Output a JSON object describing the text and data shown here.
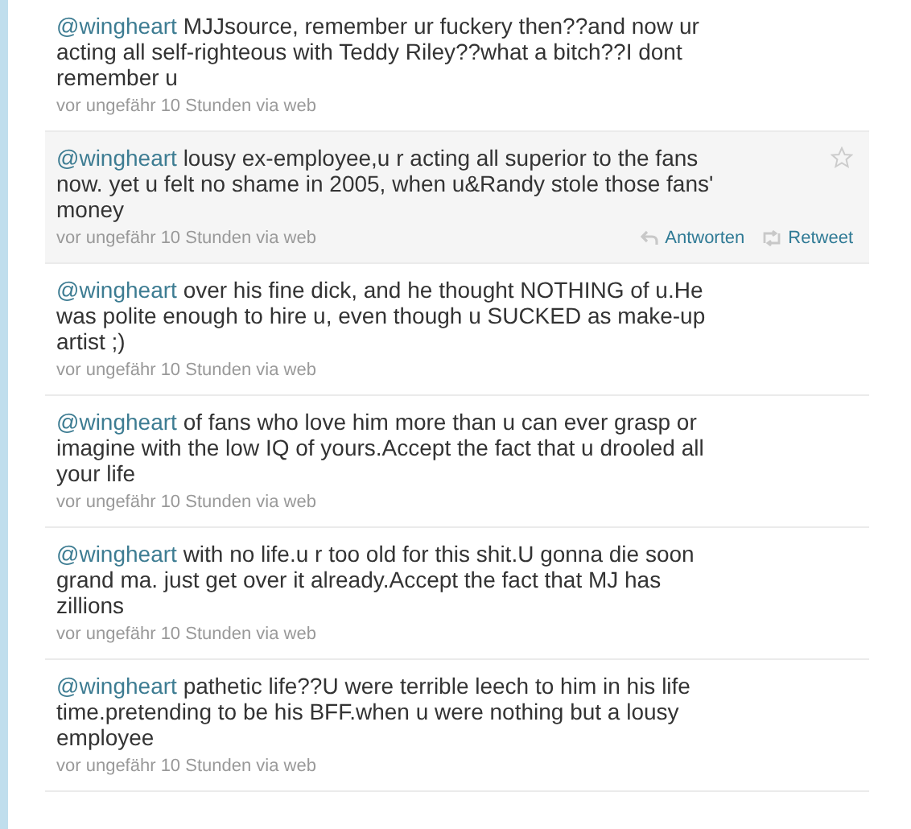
{
  "tweets": [
    {
      "mention": "@wingheart",
      "text": "MJJsource, remember ur fuckery then??and now ur acting all self-righteous with Teddy Riley??what a bitch??I dont remember u",
      "meta": "vor ungefähr 10 Stunden via web",
      "hovered": false
    },
    {
      "mention": "@wingheart",
      "text": "lousy ex-employee,u r acting all superior to the fans now. yet u felt no shame in 2005, when u&Randy stole those fans' money",
      "meta": "vor ungefähr 10 Stunden via web",
      "hovered": true,
      "actions": [
        "Antworten",
        "Retweet"
      ]
    },
    {
      "mention": "@wingheart",
      "text": "over his fine dick, and he thought NOTHING of u.He was polite enough to hire u, even though u SUCKED as make-up artist ;)",
      "meta": "vor ungefähr 10 Stunden via web",
      "hovered": false
    },
    {
      "mention": "@wingheart",
      "text": "of fans who love him more than u can ever grasp or imagine with the low IQ of yours.Accept the fact that u drooled all your life",
      "meta": "vor ungefähr 10 Stunden via web",
      "hovered": false
    },
    {
      "mention": "@wingheart",
      "text": "with no life.u r too old for this shit.U gonna die soon grand ma. just get over it already.Accept the fact that MJ has zillions",
      "meta": "vor ungefähr 10 Stunden via web",
      "hovered": false
    },
    {
      "mention": "@wingheart",
      "text": "pathetic life??U were terrible leech to him in his life time.pretending to be his BFF.when u were nothing but a lousy employee",
      "meta": "vor ungefähr 10 Stunden via web",
      "hovered": false
    }
  ]
}
